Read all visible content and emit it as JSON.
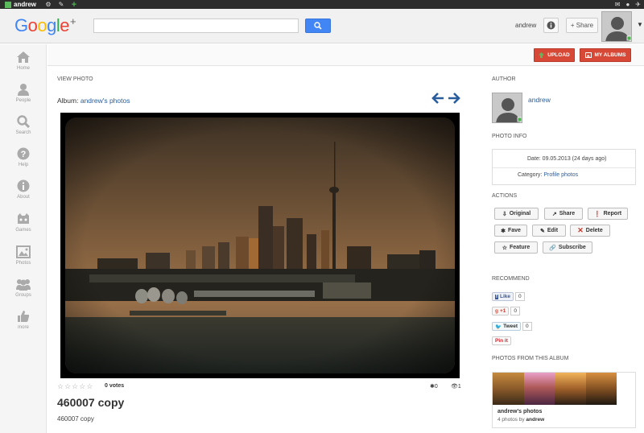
{
  "topbar": {
    "username": "andrew"
  },
  "header": {
    "logo": "Google",
    "logo_plus": "+",
    "search_placeholder": "",
    "user": "andrew",
    "share_label": "+ Share"
  },
  "sidebar": {
    "items": [
      {
        "label": "Home",
        "icon": "home-icon"
      },
      {
        "label": "People",
        "icon": "person-icon"
      },
      {
        "label": "Search",
        "icon": "search-icon"
      },
      {
        "label": "Help",
        "icon": "help-icon"
      },
      {
        "label": "About",
        "icon": "info-icon"
      },
      {
        "label": "Games",
        "icon": "games-icon"
      },
      {
        "label": "Photos",
        "icon": "photos-icon"
      },
      {
        "label": "Groups",
        "icon": "groups-icon"
      },
      {
        "label": "more",
        "icon": "thumbs-up-icon"
      }
    ]
  },
  "toolbar": {
    "upload_label": "UPLOAD",
    "albums_label": "MY ALBUMS"
  },
  "main": {
    "section_label": "VIEW PHOTO",
    "album_prefix": "Album:",
    "album_name": "andrew's photos",
    "votes": "0 votes",
    "fave_count": "0",
    "view_count": "1",
    "title": "460007 copy",
    "subtitle": "460007 copy"
  },
  "right": {
    "author_label": "AUTHOR",
    "author_name": "andrew",
    "photo_info_label": "PHOTO INFO",
    "date_text": "Date: 09.05.2013 (24 days ago)",
    "category_prefix": "Category:",
    "category_value": "Profile photos",
    "actions_label": "ACTIONS",
    "actions": {
      "original": "Original",
      "share": "Share",
      "report": "Report",
      "fave": "Fave",
      "edit": "Edit",
      "delete": "Delete",
      "feature": "Feature",
      "subscribe": "Subscribe"
    },
    "recommend_label": "RECOMMEND",
    "recommend": {
      "like_label": "Like",
      "like_count": "0",
      "plusone_label": "+1",
      "plusone_count": "0",
      "tweet_label": "Tweet",
      "tweet_count": "0",
      "pinit_label": "Pin it"
    },
    "album_section_label": "PHOTOS FROM THIS ALBUM",
    "album_card_title": "andrew's photos",
    "album_card_sub_prefix": "4 photos by",
    "album_card_sub_author": "andrew"
  },
  "colors": {
    "accent_blue": "#2a5d9c",
    "button_red": "#d74936",
    "search_blue": "#4285f4"
  }
}
